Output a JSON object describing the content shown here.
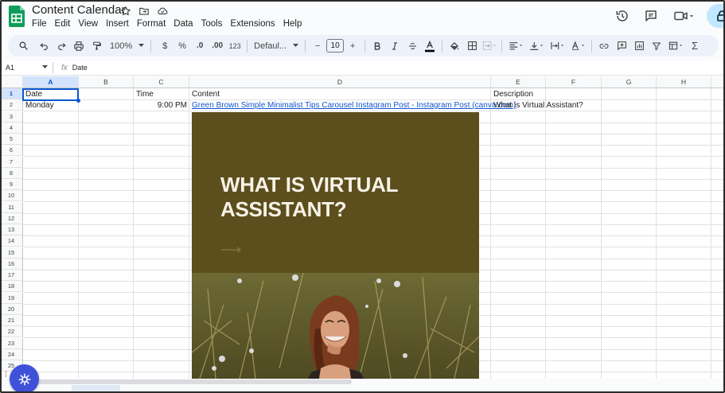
{
  "app": {
    "title": "Content Calendar",
    "menu": [
      "File",
      "Edit",
      "View",
      "Insert",
      "Format",
      "Data",
      "Tools",
      "Extensions",
      "Help"
    ]
  },
  "toolbar": {
    "zoom": "100%",
    "currency": "$",
    "percent": "%",
    "decrease_decimal": ".0",
    "increase_decimal": ".00",
    "number_format": "123",
    "font": "Defaul...",
    "font_size": "10",
    "minus": "−",
    "plus": "+"
  },
  "formula_bar": {
    "cell_ref": "A1",
    "fx": "fx",
    "value": "Date"
  },
  "columns": [
    "A",
    "B",
    "C",
    "D",
    "E",
    "F",
    "G",
    "H"
  ],
  "rows": [
    "1",
    "2",
    "3",
    "4",
    "5",
    "6",
    "7",
    "8",
    "9",
    "10",
    "11",
    "12",
    "13",
    "14",
    "15",
    "16",
    "17",
    "18",
    "19",
    "20",
    "21",
    "22",
    "23",
    "24",
    "25"
  ],
  "cells": {
    "A1": "Date",
    "C1": "Time",
    "D1": "Content",
    "E1": "Description",
    "A2": "Monday",
    "C2": "9:00 PM",
    "D2": "Green Brown Simple Minimalist Tips Carousel Instagram Post - Instagram Post (canva.com)",
    "E2": "What is Virtual Assistant?"
  },
  "embedded_image": {
    "heading_line1": "WHAT IS VIRTUAL",
    "heading_line2": "ASSISTANT?"
  },
  "colors": {
    "accent": "#0b57d0",
    "sheets_green": "#0f9d58",
    "embed_bg": "#5d4e1d",
    "fab": "#3f51d8"
  }
}
